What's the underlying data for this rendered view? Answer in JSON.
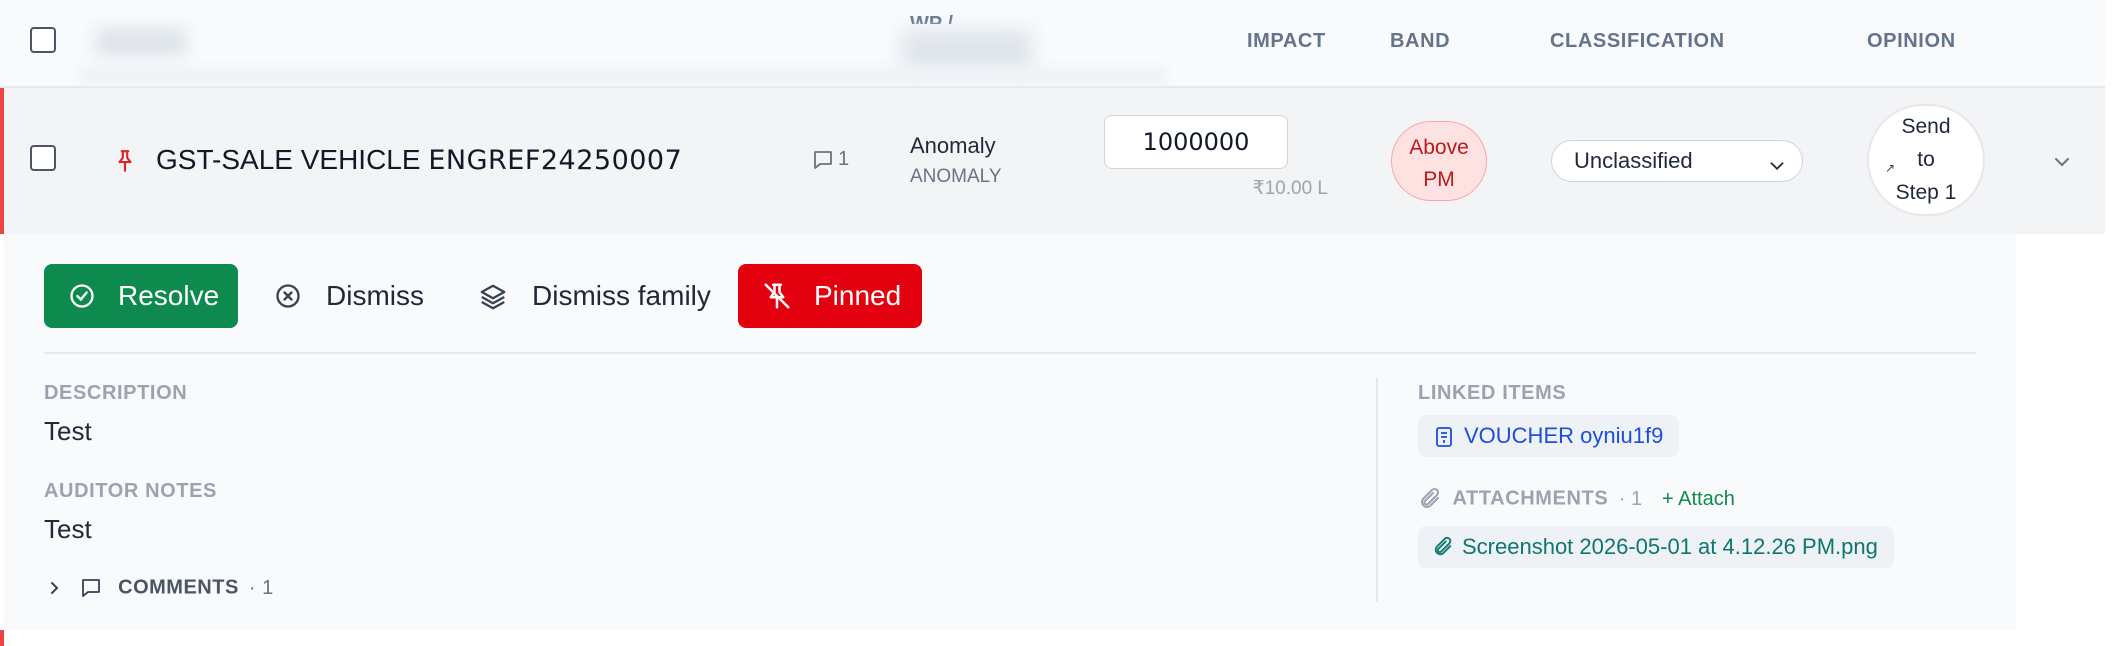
{
  "header": {
    "columns": {
      "wp": "WP /",
      "impact": "IMPACT",
      "band": "BAND",
      "classification": "CLASSIFICATION",
      "opinion": "OPINION"
    }
  },
  "row": {
    "title_prefix": "GST-SALE VEHICLE",
    "title_ref": "ENGREF24250007",
    "comment_count": "1",
    "type": "Anomaly",
    "type_code": "ANOMALY",
    "impact_value": "1000000",
    "impact_formatted": "₹10.00 L",
    "band_line1": "Above",
    "band_line2": "PM",
    "classification": "Unclassified",
    "opinion_line1": "Send",
    "opinion_line2": "to",
    "opinion_line3": "Step 1"
  },
  "actions": {
    "resolve": "Resolve",
    "dismiss": "Dismiss",
    "dismiss_family": "Dismiss family",
    "pinned": "Pinned"
  },
  "details": {
    "description_label": "DESCRIPTION",
    "description": "Test",
    "auditor_notes_label": "AUDITOR NOTES",
    "auditor_notes": "Test",
    "comments_label": "COMMENTS",
    "comments_count": "· 1"
  },
  "linked": {
    "label": "LINKED ITEMS",
    "item": "VOUCHER oyniu1f9",
    "attachments_label": "ATTACHMENTS",
    "attachments_count": "· 1",
    "attach_action": "+ Attach",
    "attachment_file": "Screenshot 2026-05-01 at 4.12.26 PM.png"
  },
  "colors": {
    "accent_red": "#ef4444",
    "resolve_green": "#0f8a4e",
    "pinned_red": "#e3000f",
    "band_bg": "#fee2e2",
    "link_blue": "#1d4ed8"
  },
  "icons": [
    "pin-icon",
    "comment-icon",
    "chevron-down-icon",
    "check-circle-icon",
    "x-circle-icon",
    "layers-icon",
    "pin-off-icon",
    "chevron-right-icon",
    "voucher-icon",
    "paperclip-icon",
    "arrow-up-right-icon"
  ]
}
